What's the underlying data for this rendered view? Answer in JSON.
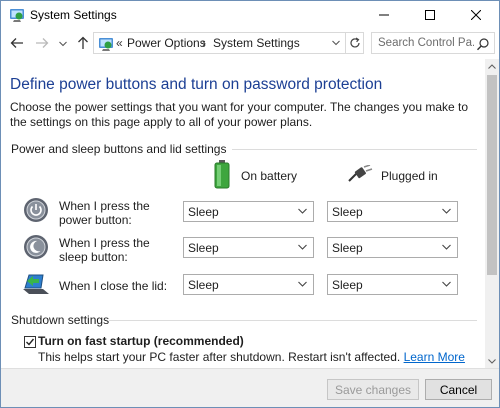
{
  "window": {
    "title": "System Settings"
  },
  "nav": {
    "breadcrumb_sep": "«",
    "crumbs": [
      "Power Options",
      "System Settings"
    ],
    "crumb_arrow": "›",
    "search_placeholder": "Search Control Pa..."
  },
  "page": {
    "heading": "Define power buttons and turn on password protection",
    "intro": "Choose the power settings that you want for your computer. The changes you make to the settings on this page apply to all of your power plans.",
    "section_power": "Power and sleep buttons and lid settings",
    "col_battery": "On battery",
    "col_plugged": "Plugged in",
    "rows": [
      {
        "label": "When I press the power button:",
        "battery": "Sleep",
        "plugged": "Sleep",
        "icon": "power-button-icon"
      },
      {
        "label": "When I press the sleep button:",
        "battery": "Sleep",
        "plugged": "Sleep",
        "icon": "sleep-button-icon"
      },
      {
        "label": "When I close the lid:",
        "battery": "Sleep",
        "plugged": "Sleep",
        "icon": "laptop-lid-icon"
      }
    ],
    "section_shutdown": "Shutdown settings",
    "fast_startup_label": "Turn on fast startup (recommended)",
    "fast_startup_checked": true,
    "fast_startup_desc": "This helps start your PC faster after shutdown. Restart isn't affected.",
    "learn_more": "Learn More"
  },
  "footer": {
    "save_label": "Save changes",
    "cancel_label": "Cancel"
  },
  "colors": {
    "heading": "#1c3f94",
    "link": "#0066cc"
  }
}
